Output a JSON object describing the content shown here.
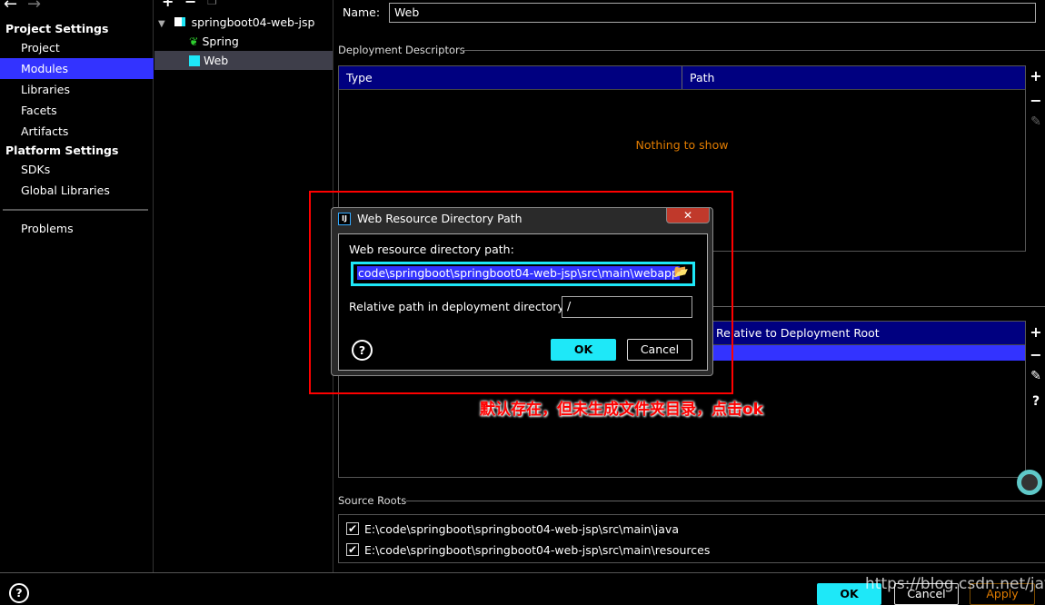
{
  "sidebar": {
    "section1": "Project Settings",
    "items1": [
      "Project",
      "Modules",
      "Libraries",
      "Facets",
      "Artifacts"
    ],
    "section2": "Platform Settings",
    "items2": [
      "SDKs",
      "Global Libraries"
    ],
    "problems": "Problems",
    "selected": "Modules"
  },
  "tree": {
    "root": "springboot04-web-jsp",
    "children": [
      "Spring",
      "Web"
    ]
  },
  "main": {
    "name_label": "Name:",
    "name_value": "Web",
    "dd_section": "Deployment Descriptors",
    "dd_columns": [
      "Type",
      "Path"
    ],
    "dd_empty": "Nothing to show",
    "wr_columns": [
      "Relative to Deployment Root"
    ],
    "source_roots_section": "Source Roots",
    "source_roots": [
      "E:\\code\\springboot\\springboot04-web-jsp\\src\\main\\java",
      "E:\\code\\springboot\\springboot04-web-jsp\\src\\main\\resources"
    ]
  },
  "dialog": {
    "title": "Web Resource Directory Path",
    "path_label": "Web resource directory path:",
    "path_value": "code\\springboot\\springboot04-web-jsp\\src\\main\\webapp",
    "rel_label": "Relative path in deployment directory:",
    "rel_value": "/",
    "ok": "OK",
    "cancel": "Cancel",
    "close": "✕"
  },
  "annotation": "默认存在，但未生成文件夹目录，点击ok",
  "footer": {
    "ok": "OK",
    "cancel": "Cancel",
    "apply": "Apply",
    "watermark": "https://blog.csdn.net/jatpen"
  },
  "colors": {
    "accent": "#3333ff",
    "header": "#000080",
    "ok": "#1ee8f8",
    "empty": "#e07b00",
    "annotation": "#ff0000"
  }
}
